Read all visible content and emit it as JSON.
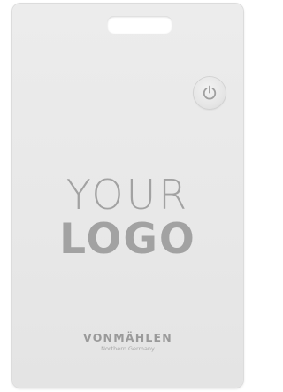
{
  "card": {
    "logo_placeholder": {
      "line1": "YOUR",
      "line2": "LOGO"
    },
    "brand": {
      "name": "VONMÄHLEN",
      "tagline": "Northern Germany"
    },
    "power_button": {
      "icon": "power-icon"
    }
  },
  "colors": {
    "card": "#e8e8e8",
    "logo_text": "#a2a2a2",
    "brand_text": "#9a9a9a"
  }
}
